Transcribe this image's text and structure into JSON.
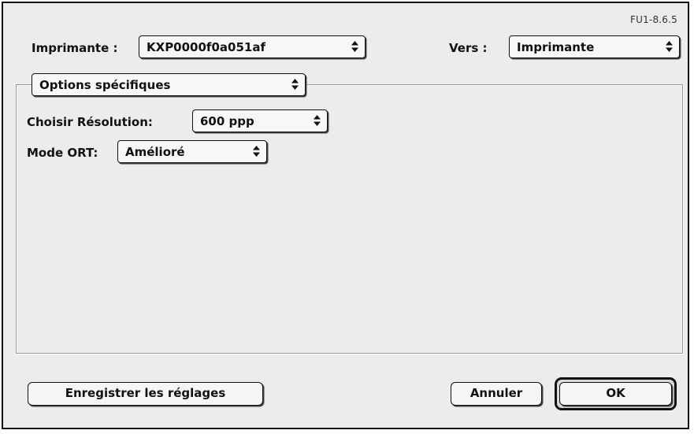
{
  "version": "FU1-8.6.5",
  "printer": {
    "label": "Imprimante :",
    "value": "KXP0000f0a051af"
  },
  "destination": {
    "label": "Vers :",
    "value": "Imprimante"
  },
  "section": {
    "value": "Options spécifiques"
  },
  "resolution": {
    "label": "Choisir Résolution:",
    "value": "600 ppp"
  },
  "ort_mode": {
    "label": "Mode ORT:",
    "value": "Amélioré"
  },
  "buttons": {
    "save_settings": "Enregistrer les réglages",
    "cancel": "Annuler",
    "ok": "OK"
  },
  "icons": {
    "popup_arrows": "up-down-arrows-icon"
  }
}
